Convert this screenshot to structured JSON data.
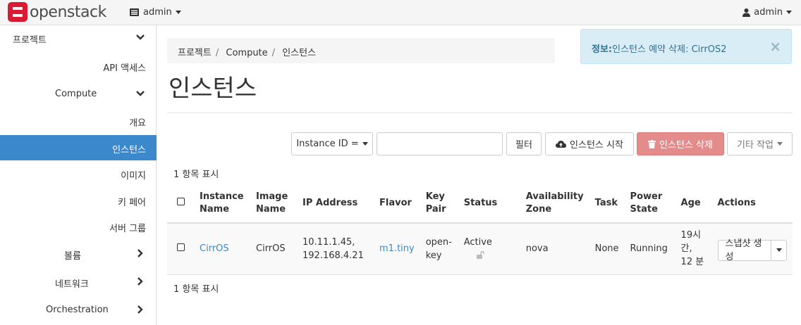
{
  "topbar": {
    "brand": "openstack",
    "project": "admin",
    "user": "admin"
  },
  "sidebar": {
    "items": [
      {
        "label": "프로젝트",
        "chevron": "down"
      },
      {
        "label": "API 액세스"
      },
      {
        "label": "Compute",
        "chevron": "down"
      },
      {
        "label": "개요"
      },
      {
        "label": "인스턴스",
        "active": true
      },
      {
        "label": "이미지"
      },
      {
        "label": "키 페어"
      },
      {
        "label": "서버 그룹"
      },
      {
        "label": "볼륨",
        "chevron": "right"
      },
      {
        "label": "네트워크",
        "chevron": "right"
      },
      {
        "label": "Orchestration",
        "chevron": "right"
      }
    ]
  },
  "breadcrumb": [
    "프로젝트",
    "Compute",
    "인스턴스"
  ],
  "page_title": "인스턴스",
  "alert": {
    "prefix": "정보:",
    "message": "인스턴스 예약 삭제: CirrOS2",
    "close": "×"
  },
  "toolbar": {
    "filter_select": "Instance ID =",
    "filter_placeholder": "",
    "filter_button": "필터",
    "launch_button": "인스턴스 시작",
    "delete_button": "인스턴스 삭제",
    "more_button": "기타 작업"
  },
  "count_label": "1 항목 표시",
  "table": {
    "headers": [
      "",
      "Instance Name",
      "Image Name",
      "IP Address",
      "Flavor",
      "Key Pair",
      "Status",
      "Availability Zone",
      "Task",
      "Power State",
      "Age",
      "Actions"
    ],
    "rows": [
      {
        "instance_name": "CirrOS",
        "image_name": "CirrOS",
        "ip_1": "10.11.1.45,",
        "ip_2": "192.168.4.21",
        "flavor": "m1.tiny",
        "key_pair": "open-key",
        "status": "Active",
        "az": "nova",
        "task": "None",
        "power_state": "Running",
        "age": "19시 간, 12 분",
        "action": "스냅샷 생성"
      }
    ]
  },
  "colors": {
    "accent": "#3c88cc",
    "brand": "#da1a32",
    "danger": "#e48b8b",
    "info_bg": "#d9edf7"
  }
}
